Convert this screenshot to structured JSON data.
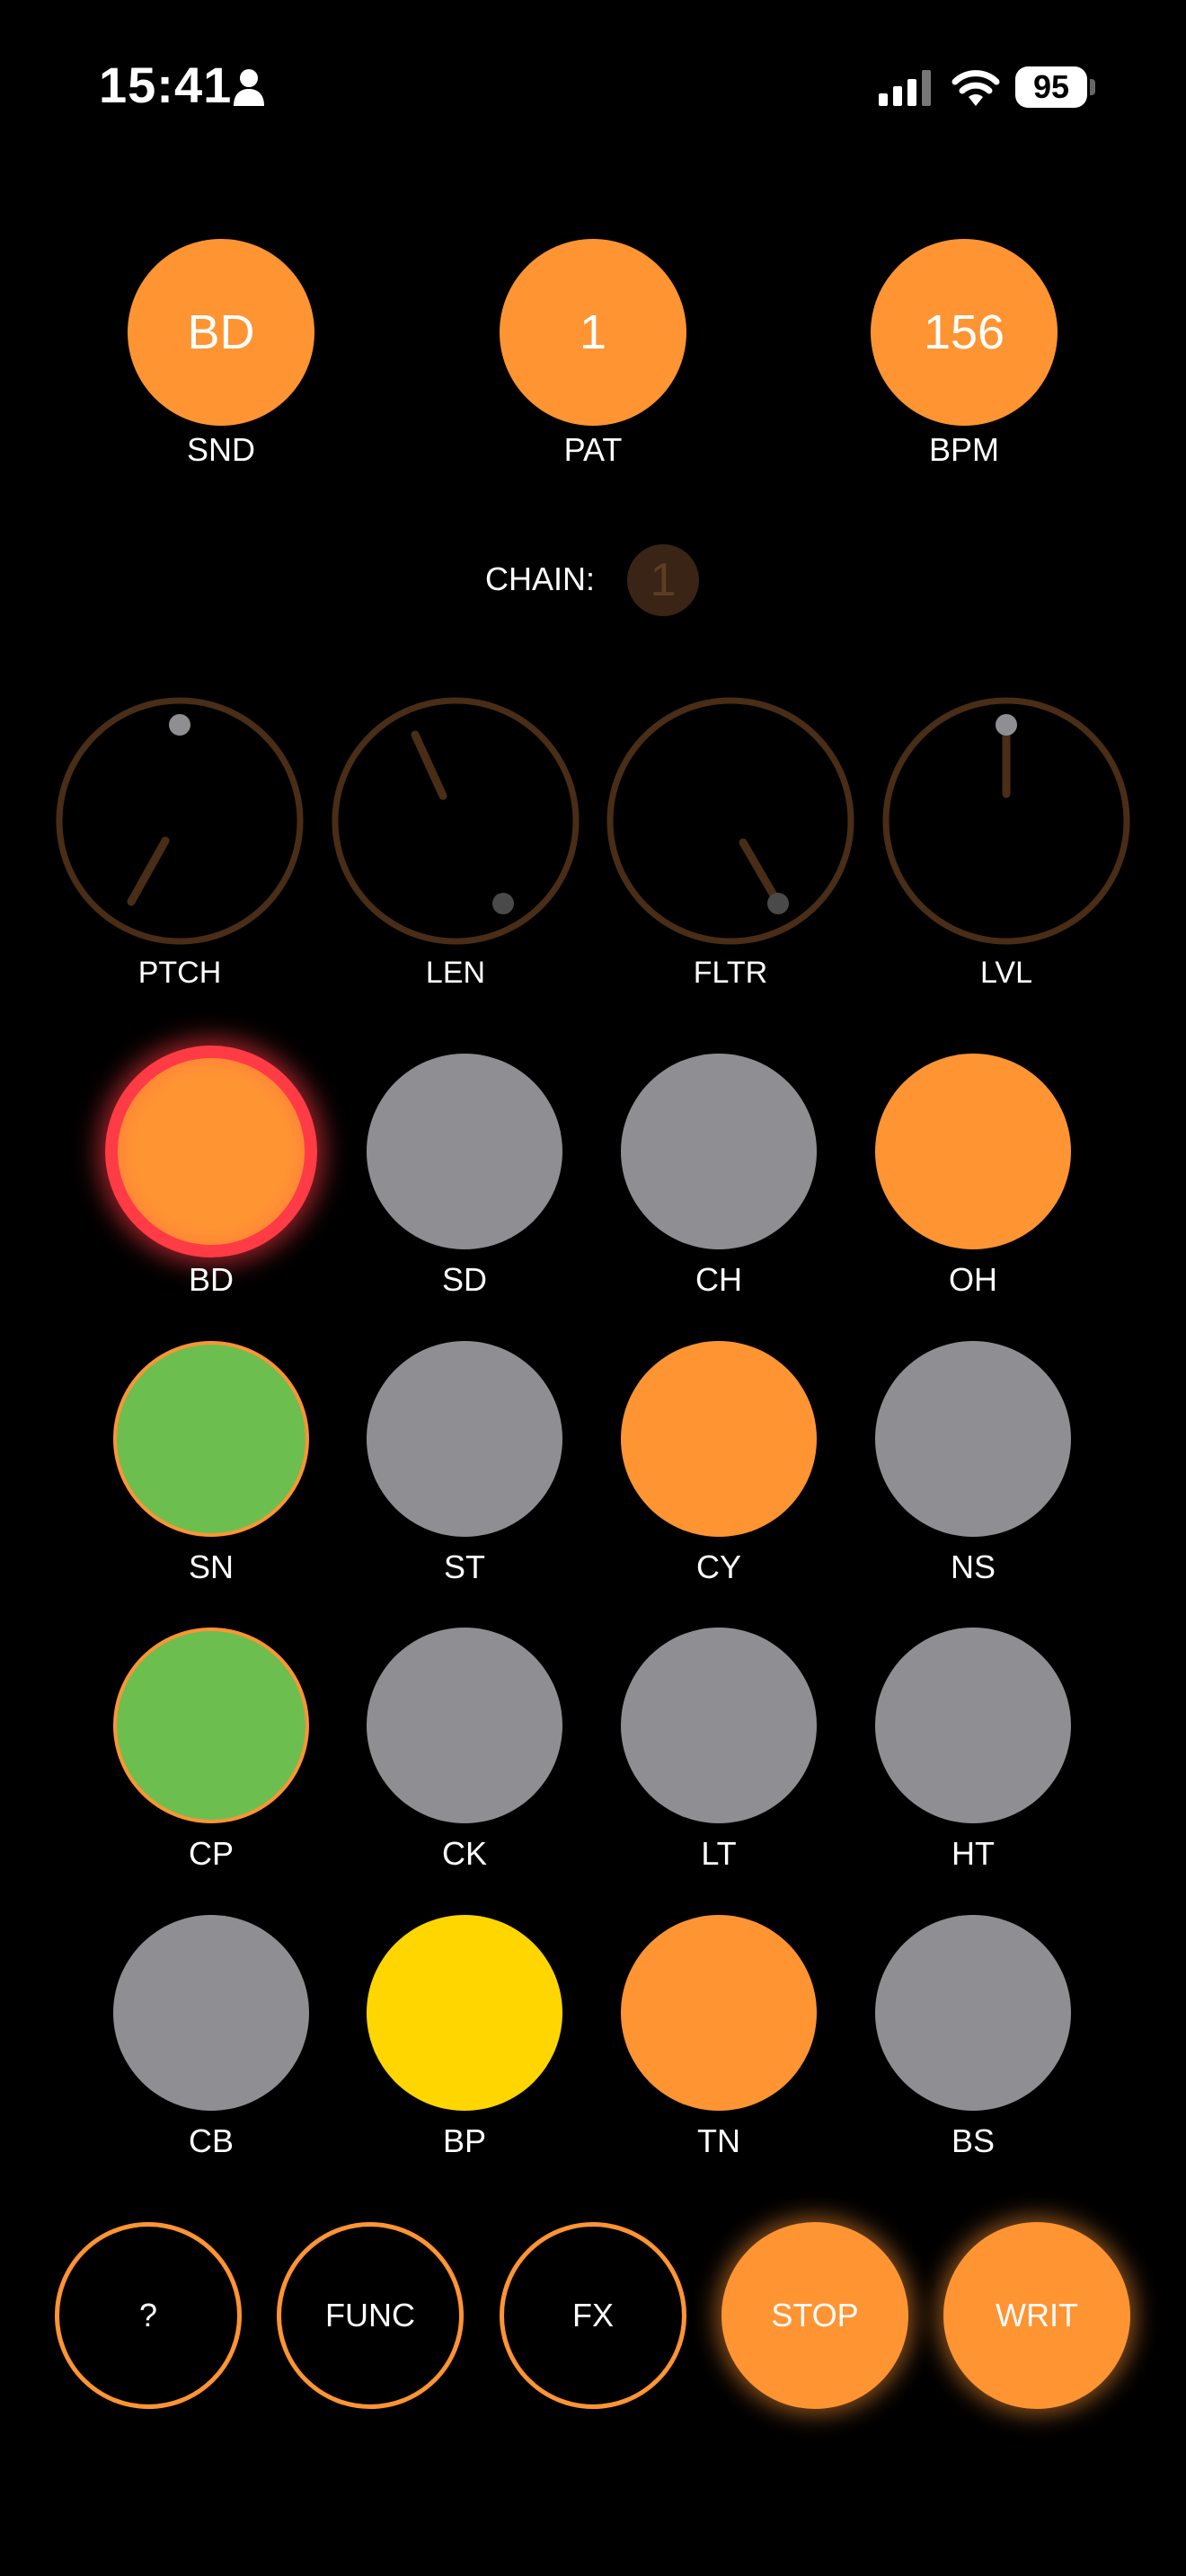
{
  "status": {
    "time": "15:41",
    "battery": "95"
  },
  "top": [
    {
      "value": "BD",
      "label": "SND"
    },
    {
      "value": "1",
      "label": "PAT"
    },
    {
      "value": "156",
      "label": "BPM"
    }
  ],
  "chain": {
    "label": "CHAIN:",
    "value": "1"
  },
  "knobs": [
    {
      "label": "PTCH"
    },
    {
      "label": "LEN"
    },
    {
      "label": "FLTR"
    },
    {
      "label": "LVL"
    }
  ],
  "pads": [
    {
      "label": "BD",
      "color": "#FF9433",
      "state": "selected"
    },
    {
      "label": "SD",
      "color": "#8E8E93"
    },
    {
      "label": "CH",
      "color": "#8E8E93"
    },
    {
      "label": "OH",
      "color": "#FF9433"
    },
    {
      "label": "SN",
      "color": "#6CBF4F"
    },
    {
      "label": "ST",
      "color": "#8E8E93"
    },
    {
      "label": "CY",
      "color": "#FF9433"
    },
    {
      "label": "NS",
      "color": "#8E8E93"
    },
    {
      "label": "CP",
      "color": "#6CBF4F"
    },
    {
      "label": "CK",
      "color": "#8E8E93"
    },
    {
      "label": "LT",
      "color": "#8E8E93"
    },
    {
      "label": "HT",
      "color": "#8E8E93"
    },
    {
      "label": "CB",
      "color": "#8E8E93"
    },
    {
      "label": "BP",
      "color": "#FFD600"
    },
    {
      "label": "TN",
      "color": "#FF9433"
    },
    {
      "label": "BS",
      "color": "#8E8E93"
    }
  ],
  "buttons": [
    {
      "label": "?"
    },
    {
      "label": "FUNC"
    },
    {
      "label": "FX"
    },
    {
      "label": "STOP"
    },
    {
      "label": "WRIT"
    }
  ],
  "colors": {
    "accent": "#FF9433",
    "knob_ring": "#4A2D16",
    "knob_dot": "#8E8E93"
  }
}
